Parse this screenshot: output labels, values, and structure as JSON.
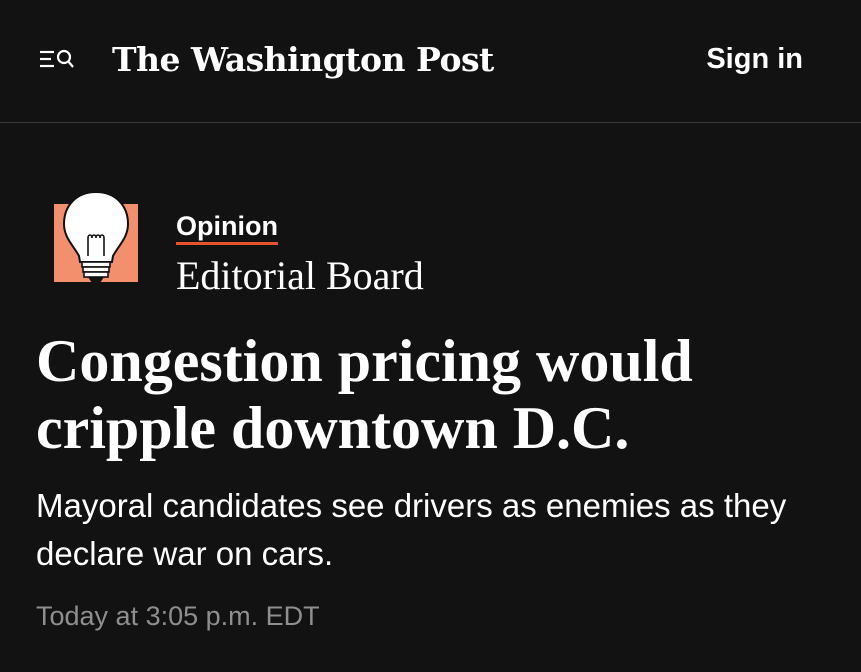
{
  "header": {
    "menu_icon": "menu-search-icon",
    "masthead": "The Washington Post",
    "signin_label": "Sign in"
  },
  "byline": {
    "section": "Opinion",
    "author": "Editorial Board",
    "author_icon": "lightbulb-icon",
    "accent_color": "#e8532e",
    "icon_bg_color": "#f2906e"
  },
  "article": {
    "headline": "Congestion pricing would cripple downtown D.C.",
    "dek": "Mayoral candidates see drivers as enemies as they declare war on cars.",
    "timestamp": "Today at 3:05 p.m. EDT"
  }
}
